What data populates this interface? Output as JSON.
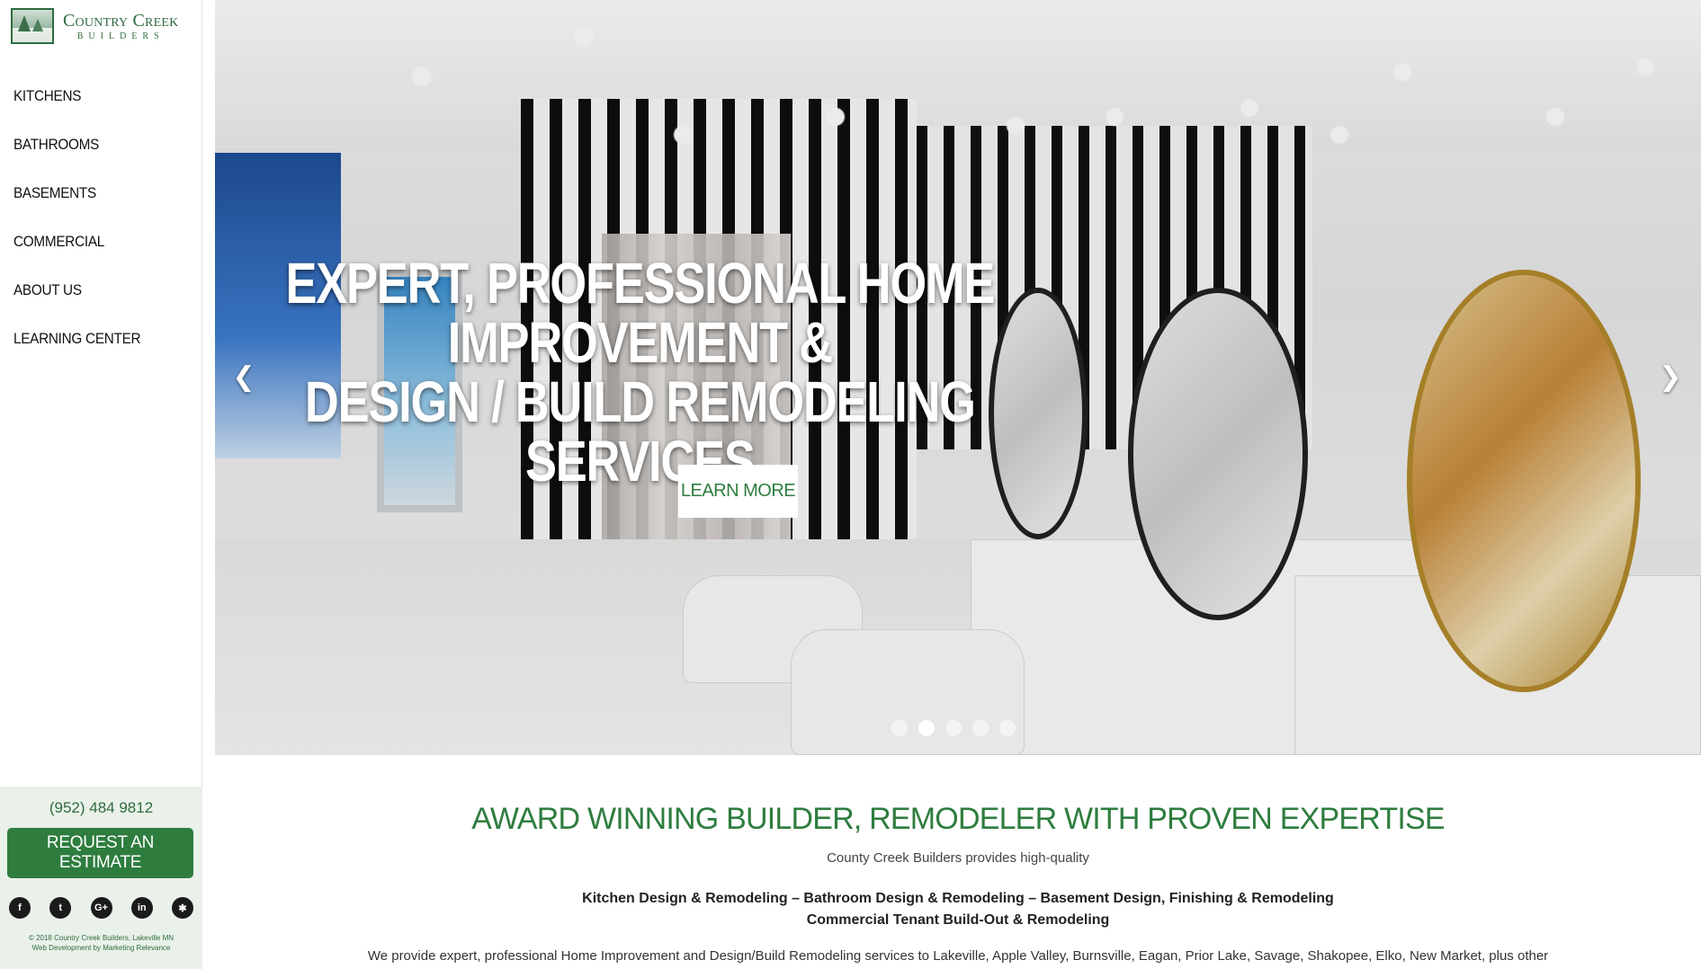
{
  "logo": {
    "name": "Country Creek",
    "sub": "BUILDERS"
  },
  "nav": [
    {
      "label": "KITCHENS"
    },
    {
      "label": "BATHROOMS"
    },
    {
      "label": "BASEMENTS"
    },
    {
      "label": "COMMERCIAL"
    },
    {
      "label": "ABOUT US"
    },
    {
      "label": "LEARNING CENTER"
    }
  ],
  "sidebar_bottom": {
    "phone": "(952) 484 9812",
    "estimate_label": "REQUEST AN ESTIMATE",
    "social_icons": [
      "facebook-icon",
      "twitter-icon",
      "google-plus-icon",
      "linkedin-icon",
      "yelp-icon"
    ],
    "social_glyphs": [
      "f",
      "t",
      "G+",
      "in",
      "✱"
    ],
    "copyright_line1": "© 2018 Country Creek Builders, Lakeville MN",
    "copyright_line2": "Web Development by Marketing Relevance"
  },
  "hero": {
    "headline_line1": "EXPERT, PROFESSIONAL HOME IMPROVEMENT &",
    "headline_line2": "DESIGN / BUILD REMODELING SERVICES",
    "cta_label": "LEARN MORE",
    "prev_glyph": "❮",
    "next_glyph": "❯",
    "slide_count": 5,
    "active_slide": 2
  },
  "main": {
    "heading": "AWARD WINNING BUILDER, REMODELER WITH PROVEN EXPERTISE",
    "tagline": "County Creek Builders provides high-quality",
    "services_line1": "Kitchen Design & Remodeling – Bathroom Design & Remodeling – Basement Design, Finishing & Remodeling",
    "services_line2": "Commercial Tenant Build-Out & Remodeling",
    "description": "We provide expert, professional Home Improvement and Design/Build Remodeling services to Lakeville, Apple Valley, Burnsville, Eagan, Prior Lake, Savage, Shakopee, Elko, New Market, plus other"
  },
  "colors": {
    "brand_green": "#2e7d3f",
    "sidebar_bottom_bg": "#e9f1ea"
  }
}
